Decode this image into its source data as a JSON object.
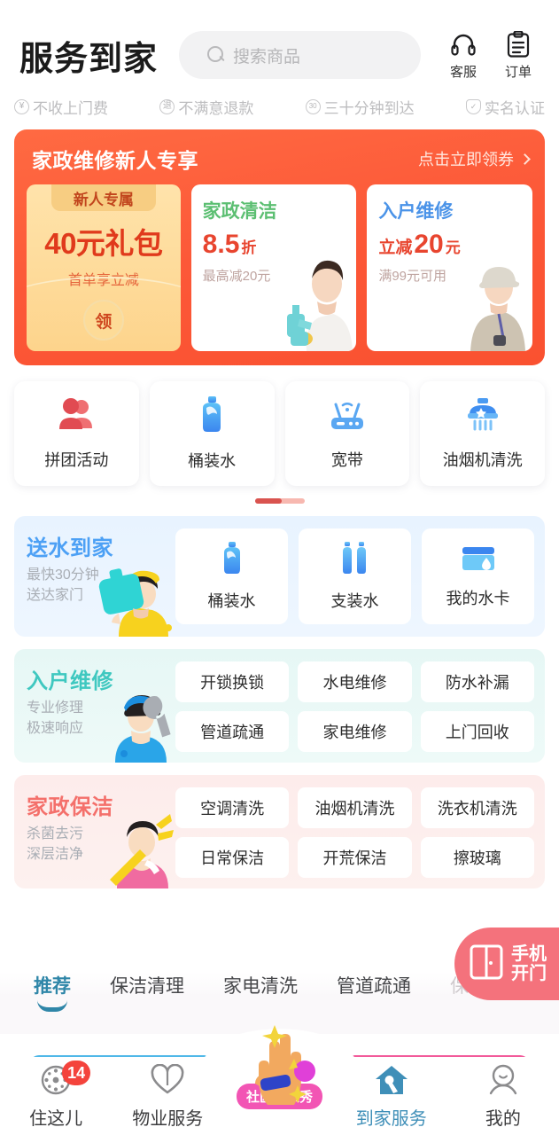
{
  "header": {
    "brand": "服务到家",
    "search_placeholder": "搜索商品",
    "actions": [
      {
        "icon": "headset-icon",
        "label": "客服"
      },
      {
        "icon": "clipboard-icon",
        "label": "订单"
      }
    ]
  },
  "badges": [
    {
      "icon": "yuan-icon",
      "glyph": "¥",
      "text": "不收上门费"
    },
    {
      "icon": "refund-icon",
      "glyph": "退",
      "text": "不满意退款"
    },
    {
      "icon": "clock30-icon",
      "glyph": "30",
      "text": "三十分钟到达"
    },
    {
      "icon": "shield-check-icon",
      "glyph": "✓",
      "text": "实名认证"
    }
  ],
  "banner": {
    "title": "家政维修新人专享",
    "cta": "点击立即领券",
    "chevron_icon": "chevron-right-icon",
    "accent": "#fa5130",
    "coupons": [
      {
        "type": "gift",
        "tag": "新人专属",
        "amount": "40元礼包",
        "sub": "首单享立减",
        "button": "领"
      },
      {
        "type": "discount",
        "heading": "家政清洁",
        "heading_color": "#5cbf72",
        "big_prefix": "",
        "big_num": "8.5",
        "big_unit": "折",
        "note": "最高减20元",
        "illustration": "woman-cleaner-photo"
      },
      {
        "type": "cash",
        "heading": "入户维修",
        "heading_color": "#4a93e8",
        "big_prefix": "立减",
        "big_num": "20",
        "big_unit": "元",
        "note": "满99元可用",
        "illustration": "man-technician-photo"
      }
    ]
  },
  "quick_entries": [
    {
      "icon": "group-buy-icon",
      "label": "拼团活动"
    },
    {
      "icon": "water-barrel-icon",
      "label": "桶装水"
    },
    {
      "icon": "router-icon",
      "label": "宽带"
    },
    {
      "icon": "range-hood-icon",
      "label": "油烟机清洗"
    }
  ],
  "pager": {
    "pages": 2,
    "current": 1
  },
  "sections": [
    {
      "key": "water",
      "title": "送水到家",
      "title_color": "#4ca0f5",
      "sub_lines": [
        "最快30分钟",
        "送达家门"
      ],
      "mascot": "water-delivery-man-illustration",
      "layout": "cards",
      "items": [
        {
          "icon": "water-barrel-icon",
          "label": "桶装水"
        },
        {
          "icon": "bottled-water-icon",
          "label": "支装水"
        },
        {
          "icon": "water-card-icon",
          "label": "我的水卡"
        }
      ]
    },
    {
      "key": "repair",
      "title": "入户维修",
      "title_color": "#3fc8c0",
      "sub_lines": [
        "专业修理",
        "极速响应"
      ],
      "mascot": "repairman-wrench-illustration",
      "layout": "pills",
      "items": [
        {
          "label": "开锁换锁"
        },
        {
          "label": "水电维修"
        },
        {
          "label": "防水补漏"
        },
        {
          "label": "管道疏通"
        },
        {
          "label": "家电维修"
        },
        {
          "label": "上门回收"
        }
      ]
    },
    {
      "key": "cleaning",
      "title": "家政保洁",
      "title_color": "#f4706b",
      "sub_lines": [
        "杀菌去污",
        "深层洁净"
      ],
      "mascot": "cleaning-lady-illustration",
      "layout": "pills",
      "items": [
        {
          "label": "空调清洗"
        },
        {
          "label": "油烟机清洗"
        },
        {
          "label": "洗衣机清洗"
        },
        {
          "label": "日常保洁"
        },
        {
          "label": "开荒保洁"
        },
        {
          "label": "擦玻璃"
        }
      ]
    }
  ],
  "feed_tabs": [
    {
      "label": "推荐",
      "active": true
    },
    {
      "label": "保洁清理",
      "active": false
    },
    {
      "label": "家电清洗",
      "active": false
    },
    {
      "label": "管道疏通",
      "active": false
    },
    {
      "label": "保姆月嫂",
      "active": false
    }
  ],
  "fab": {
    "icon": "door-icon",
    "line1": "手机",
    "line2": "开门",
    "color": "#f4727c"
  },
  "bottom_nav": [
    {
      "icon": "compass-icon",
      "label": "住这儿",
      "badge": "14",
      "active": false
    },
    {
      "icon": "heart-icon",
      "label": "物业服务",
      "active": false
    },
    {
      "icon": "hand-rock-icon",
      "label": "社区达人秀",
      "center": true,
      "active": false
    },
    {
      "icon": "home-wrench-icon",
      "label": "到家服务",
      "active": true
    },
    {
      "icon": "person-icon",
      "label": "我的",
      "active": false
    }
  ]
}
